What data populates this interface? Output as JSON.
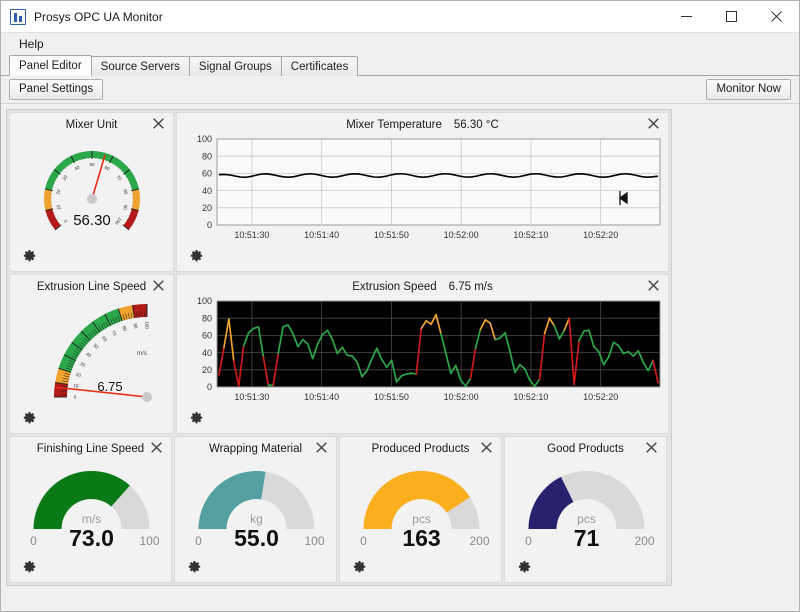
{
  "window": {
    "title": "Prosys OPC UA Monitor",
    "icon": "app-icon",
    "controls": {
      "minimize": "minimize-icon",
      "maximize": "maximize-icon",
      "close": "close-icon"
    }
  },
  "menu": {
    "items": [
      "Help"
    ]
  },
  "tabs": [
    {
      "label": "Panel Editor",
      "active": true
    },
    {
      "label": "Source Servers",
      "active": false
    },
    {
      "label": "Signal Groups",
      "active": false
    },
    {
      "label": "Certificates",
      "active": false
    }
  ],
  "toolbar": {
    "panel_settings": "Panel Settings",
    "monitor_now": "Monitor Now"
  },
  "colors": {
    "green": "#2ba84a",
    "orange": "#f0a22e",
    "red": "#b51a1a",
    "needle": "#e82c15",
    "dark_green": "#0a7a16",
    "teal": "#54a0a0",
    "amber": "#fcaf1c",
    "navy": "#27216e",
    "track": "#d9d9d9",
    "panel_bg": "#f2f2f2",
    "chart_dark_bg": "#000000"
  },
  "panels": [
    {
      "id": "mixer-unit",
      "type": "radial-gauge",
      "title": "Mixer Unit",
      "value": "56.30",
      "value_num": 56.3,
      "min": 0,
      "max": 100,
      "ticks": [
        "0",
        "10",
        "20",
        "30",
        "40",
        "50",
        "60",
        "70",
        "80",
        "90",
        "100"
      ],
      "bands": [
        {
          "from": 0,
          "to": 10,
          "color": "#b51a1a"
        },
        {
          "from": 10,
          "to": 20,
          "color": "#f0a22e"
        },
        {
          "from": 20,
          "to": 80,
          "color": "#2ba84a"
        },
        {
          "from": 80,
          "to": 90,
          "color": "#f0a22e"
        },
        {
          "from": 90,
          "to": 100,
          "color": "#b51a1a"
        }
      ]
    },
    {
      "id": "mixer-temperature",
      "type": "line-chart",
      "title": "Mixer Temperature",
      "value_label": "56.30 °C"
    },
    {
      "id": "extrusion-line-speed",
      "type": "quadrant-gauge",
      "title": "Extrusion Line Speed",
      "value": "6.75",
      "value_num": 6.75,
      "unit": "m/s",
      "min": 0,
      "max": 100,
      "ticks": [
        "0",
        "10",
        "20",
        "30",
        "40",
        "50",
        "60",
        "70",
        "80",
        "90",
        "100"
      ],
      "bands": [
        {
          "from": 0,
          "to": 10,
          "color": "#b51a1a"
        },
        {
          "from": 10,
          "to": 20,
          "color": "#f0a22e"
        },
        {
          "from": 20,
          "to": 80,
          "color": "#2ba84a"
        },
        {
          "from": 80,
          "to": 90,
          "color": "#f0a22e"
        },
        {
          "from": 90,
          "to": 100,
          "color": "#b51a1a"
        }
      ]
    },
    {
      "id": "extrusion-speed",
      "type": "line-chart-dark",
      "title": "Extrusion Speed",
      "value_label": "6.75 m/s"
    },
    {
      "id": "finishing-line-speed",
      "type": "donut-gauge",
      "title": "Finishing Line Speed",
      "value": "73.0",
      "value_num": 73,
      "unit": "m/s",
      "min": "0",
      "max": "100",
      "min_num": 0,
      "max_num": 100,
      "color": "#0a7a16"
    },
    {
      "id": "wrapping-material",
      "type": "donut-gauge",
      "title": "Wrapping Material",
      "value": "55.0",
      "value_num": 55,
      "unit": "kg",
      "min": "0",
      "max": "100",
      "min_num": 0,
      "max_num": 100,
      "color": "#54a0a0"
    },
    {
      "id": "produced-products",
      "type": "donut-gauge",
      "title": "Produced Products",
      "value": "163",
      "value_num": 163,
      "unit": "pcs",
      "min": "0",
      "max": "200",
      "min_num": 0,
      "max_num": 200,
      "color": "#fcaf1c"
    },
    {
      "id": "good-products",
      "type": "donut-gauge",
      "title": "Good Products",
      "value": "71",
      "value_num": 71,
      "unit": "pcs",
      "min": "0",
      "max": "200",
      "min_num": 0,
      "max_num": 200,
      "color": "#27216e"
    }
  ],
  "chart_data": [
    {
      "type": "line",
      "title": "Mixer Temperature",
      "annotation": "56.30 °C",
      "xlabel": "",
      "ylabel": "",
      "ylim": [
        0,
        100
      ],
      "yticks": [
        0,
        20,
        40,
        60,
        80,
        100
      ],
      "xticks": [
        "10:51:30",
        "10:51:40",
        "10:51:50",
        "10:52:00",
        "10:52:10",
        "10:52:20"
      ],
      "grid": true,
      "background": "#fafafa",
      "line_color": "#000000",
      "series": [
        {
          "name": "Mixer Temperature",
          "values": [
            58.5,
            58.8,
            58.2,
            57.0,
            55.8,
            55.5,
            56.5,
            58.0,
            59.3,
            59.5,
            58.5,
            57.2,
            56.0,
            55.6,
            56.2,
            57.6,
            59.0,
            59.6,
            59.0,
            57.8,
            56.4,
            55.6,
            55.9,
            57.2,
            58.6,
            59.5,
            59.4,
            58.3,
            56.9,
            55.8,
            55.6,
            56.5,
            58.0,
            59.2,
            59.6,
            59.0,
            57.7,
            56.3,
            55.6,
            56.0,
            57.3,
            58.8,
            59.6,
            59.3,
            58.2,
            56.8,
            55.8,
            55.7,
            56.7,
            58.2,
            59.3,
            59.6,
            58.8,
            57.5,
            56.2,
            55.6,
            56.1,
            57.5,
            58.9,
            59.6,
            59.2,
            58.0,
            56.6,
            55.7,
            55.8,
            57.0,
            58.5,
            59.5,
            59.4,
            58.5,
            57.1,
            55.9,
            55.6,
            56.3,
            57.8,
            59.1,
            59.6,
            58.9,
            57.6,
            56.2,
            55.6,
            56.0,
            56.8
          ]
        }
      ]
    },
    {
      "type": "line",
      "title": "Extrusion Speed",
      "annotation": "6.75 m/s",
      "xlabel": "",
      "ylabel": "",
      "ylim": [
        0,
        100
      ],
      "yticks": [
        0,
        20,
        40,
        60,
        80,
        100
      ],
      "xticks": [
        "10:51:30",
        "10:51:40",
        "10:51:50",
        "10:52:00",
        "10:52:10",
        "10:52:20"
      ],
      "grid": true,
      "background": "#000000",
      "color_thresholds": [
        {
          "max": 20,
          "color": "#d01a1a"
        },
        {
          "max": 80,
          "color": "#2ba84a"
        },
        {
          "max": 100,
          "color": "#f0a22e"
        }
      ],
      "series": [
        {
          "name": "Extrusion Speed",
          "values": [
            14,
            46,
            79,
            30,
            1,
            48,
            63,
            68,
            70,
            35,
            2,
            2,
            39,
            70,
            72,
            62,
            47,
            55,
            50,
            33,
            50,
            61,
            66,
            55,
            39,
            46,
            37,
            36,
            29,
            12,
            19,
            33,
            45,
            32,
            23,
            31,
            6,
            13,
            15,
            16,
            15,
            68,
            77,
            73,
            84,
            62,
            39,
            16,
            25,
            8,
            1,
            10,
            45,
            67,
            78,
            74,
            55,
            57,
            63,
            41,
            17,
            26,
            21,
            8,
            1,
            9,
            62,
            80,
            71,
            56,
            66,
            80,
            3,
            54,
            65,
            66,
            47,
            41,
            26,
            35,
            52,
            48,
            39,
            41,
            36,
            42,
            29,
            19,
            31,
            5
          ]
        }
      ]
    }
  ]
}
